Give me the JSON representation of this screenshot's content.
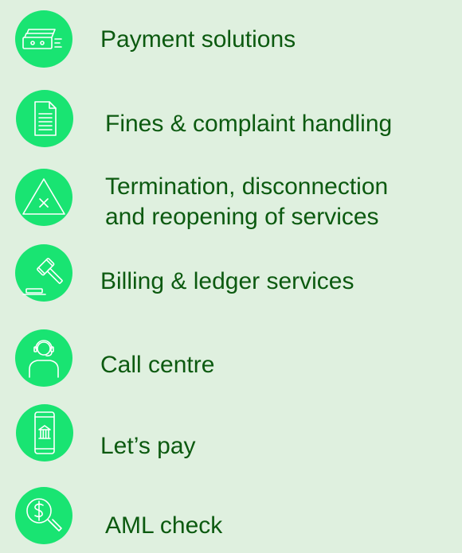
{
  "colors": {
    "background": "#dff0df",
    "icon_fill": "#19e472",
    "text": "#0c5a10",
    "icon_stroke": "#ffffff"
  },
  "services": [
    {
      "label": "Payment solutions",
      "icon": "money-icon"
    },
    {
      "label": "Fines & complaint handling",
      "icon": "document-icon"
    },
    {
      "label_line1": "Termination, disconnection",
      "label_line2": "and reopening of services",
      "icon": "warning-triangle-icon"
    },
    {
      "label": "Billing & ledger services",
      "icon": "gavel-icon"
    },
    {
      "label": "Call centre",
      "icon": "headset-user-icon"
    },
    {
      "label": "Let’s pay",
      "icon": "mobile-bank-icon"
    },
    {
      "label": "AML check",
      "icon": "dollar-magnifier-icon"
    }
  ]
}
